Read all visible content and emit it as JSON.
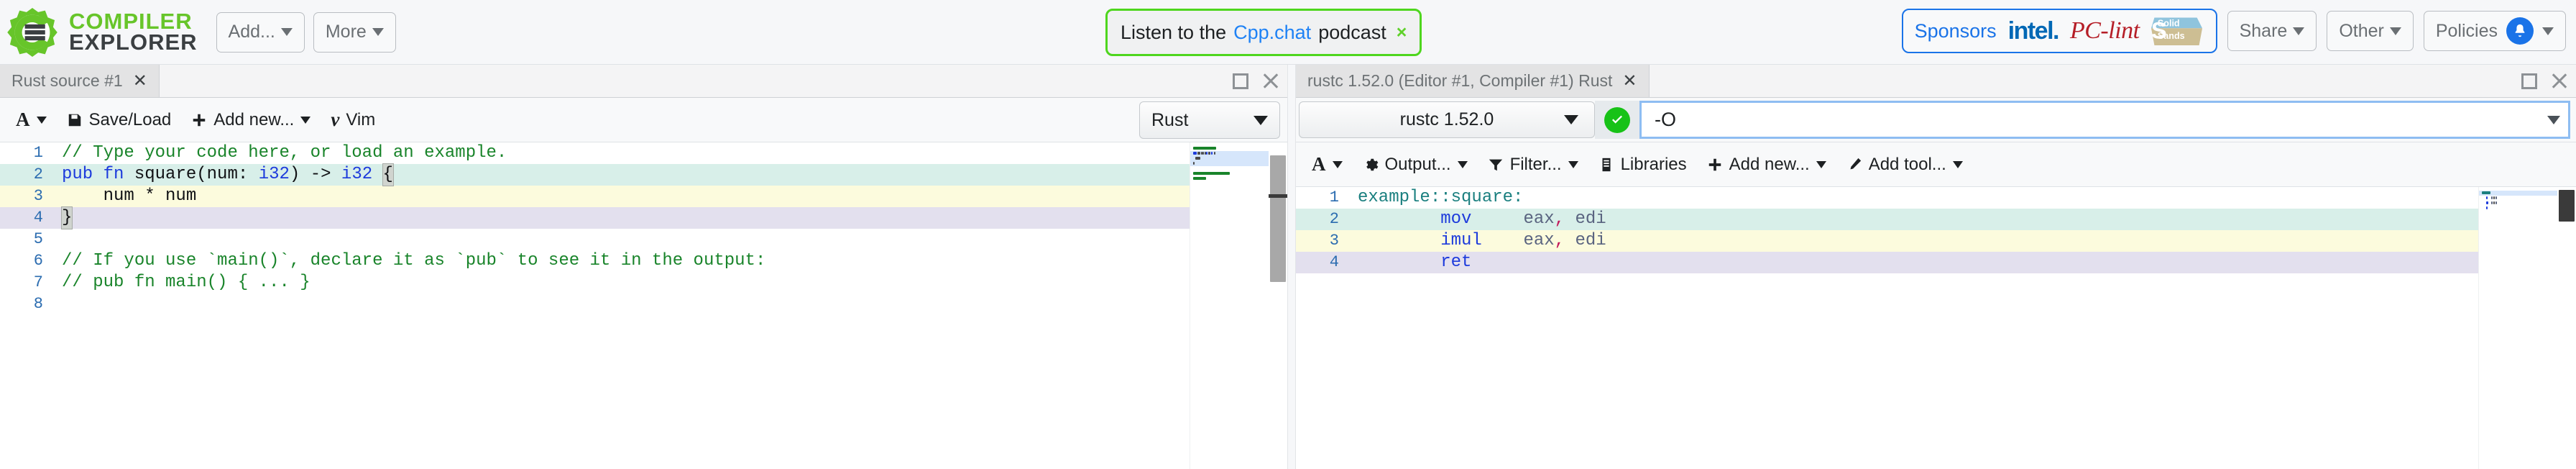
{
  "brand": {
    "line1": "COMPILER",
    "line2": "EXPLORER",
    "gear_color": "#67c52a",
    "text_dark": "#3b3f42"
  },
  "navbar": {
    "buttons": [
      {
        "label": "Add...",
        "name": "add-dropdown"
      },
      {
        "label": "More",
        "name": "more-dropdown"
      }
    ],
    "podcast": {
      "prefix": "Listen to the",
      "link": "Cpp.chat",
      "suffix": "podcast",
      "close": "×",
      "border_color": "#4ed61e",
      "link_color": "#1f82f5"
    },
    "sponsors": {
      "label": "Sponsors",
      "intel": "intel.",
      "pclint": "PC-lint",
      "solidsands_top": "Solid",
      "solidsands_bottom": "Sands",
      "border_color": "#1a73e8"
    },
    "right_buttons": [
      {
        "label": "Share",
        "name": "share-dropdown"
      },
      {
        "label": "Other",
        "name": "other-dropdown"
      },
      {
        "label": "Policies",
        "name": "policies-dropdown"
      }
    ]
  },
  "editor_pane": {
    "tab_label": "Rust source #1",
    "tab_close": "✕",
    "toolbar": {
      "font_icon": "A",
      "save_load": "Save/Load",
      "add_new": "Add new...",
      "vim_icon": "v",
      "vim": "Vim"
    },
    "language": "Rust",
    "code": [
      {
        "n": "1",
        "hl": "",
        "tokens": [
          {
            "t": "// Type your code here, or load an example.",
            "c": "tok-comment"
          }
        ]
      },
      {
        "n": "2",
        "hl": "hl-teal",
        "tokens": [
          {
            "t": "pub fn ",
            "c": "tok-kw"
          },
          {
            "t": "square",
            "c": "tok-plain"
          },
          {
            "t": "(",
            "c": "tok-plain"
          },
          {
            "t": "num",
            "c": "tok-plain"
          },
          {
            "t": ": ",
            "c": "tok-plain"
          },
          {
            "t": "i32",
            "c": "tok-type"
          },
          {
            "t": ") -> ",
            "c": "tok-plain"
          },
          {
            "t": "i32",
            "c": "tok-type"
          },
          {
            "t": " ",
            "c": "tok-plain"
          },
          {
            "t": "{",
            "c": "tok-plain brk"
          }
        ]
      },
      {
        "n": "3",
        "hl": "hl-yellow",
        "tokens": [
          {
            "t": "    num * num",
            "c": "tok-plain"
          }
        ]
      },
      {
        "n": "4",
        "hl": "hl-lav",
        "tokens": [
          {
            "t": "}",
            "c": "tok-plain brk"
          }
        ]
      },
      {
        "n": "5",
        "hl": "",
        "tokens": [
          {
            "t": "",
            "c": "tok-plain"
          }
        ]
      },
      {
        "n": "6",
        "hl": "",
        "tokens": [
          {
            "t": "// If you use `main()`, declare it as `pub` to see it in the output:",
            "c": "tok-comment"
          }
        ]
      },
      {
        "n": "7",
        "hl": "",
        "tokens": [
          {
            "t": "// pub fn main() { ... }",
            "c": "tok-comment"
          }
        ]
      },
      {
        "n": "8",
        "hl": "",
        "tokens": [
          {
            "t": "",
            "c": "tok-plain"
          }
        ]
      }
    ]
  },
  "compiler_pane": {
    "tab_label": "rustc 1.52.0 (Editor #1, Compiler #1) Rust",
    "tab_close": "✕",
    "compiler_name": "rustc 1.52.0",
    "status": "ok",
    "options_value": "-O",
    "toolbar": {
      "font_icon": "A",
      "output": "Output...",
      "filter": "Filter...",
      "libraries": "Libraries",
      "add_new": "Add new...",
      "add_tool": "Add tool..."
    },
    "asm": [
      {
        "n": "1",
        "hl": "",
        "tokens": [
          {
            "t": "example::square:",
            "c": "tok-label"
          }
        ]
      },
      {
        "n": "2",
        "hl": "hl-teal",
        "tokens": [
          {
            "t": "        ",
            "c": "tok-plain"
          },
          {
            "t": "mov",
            "c": "tok-mn"
          },
          {
            "t": "     ",
            "c": "tok-plain"
          },
          {
            "t": "eax",
            "c": "tok-reg"
          },
          {
            "t": ",",
            "c": "tok-punct"
          },
          {
            "t": " edi",
            "c": "tok-reg"
          }
        ]
      },
      {
        "n": "3",
        "hl": "hl-yellow",
        "tokens": [
          {
            "t": "        ",
            "c": "tok-plain"
          },
          {
            "t": "imul",
            "c": "tok-mn"
          },
          {
            "t": "    ",
            "c": "tok-plain"
          },
          {
            "t": "eax",
            "c": "tok-reg"
          },
          {
            "t": ",",
            "c": "tok-punct"
          },
          {
            "t": " edi",
            "c": "tok-reg"
          }
        ]
      },
      {
        "n": "4",
        "hl": "hl-lav",
        "tokens": [
          {
            "t": "        ",
            "c": "tok-plain"
          },
          {
            "t": "ret",
            "c": "tok-mn"
          }
        ]
      }
    ]
  },
  "colors": {
    "brand_green": "#67c52a",
    "accent_blue": "#1a73e8",
    "status_green": "#17c217",
    "highlight_teal": "#d8efe9",
    "highlight_yellow": "#fcfbdd",
    "highlight_lavender": "#e3e0ee"
  }
}
